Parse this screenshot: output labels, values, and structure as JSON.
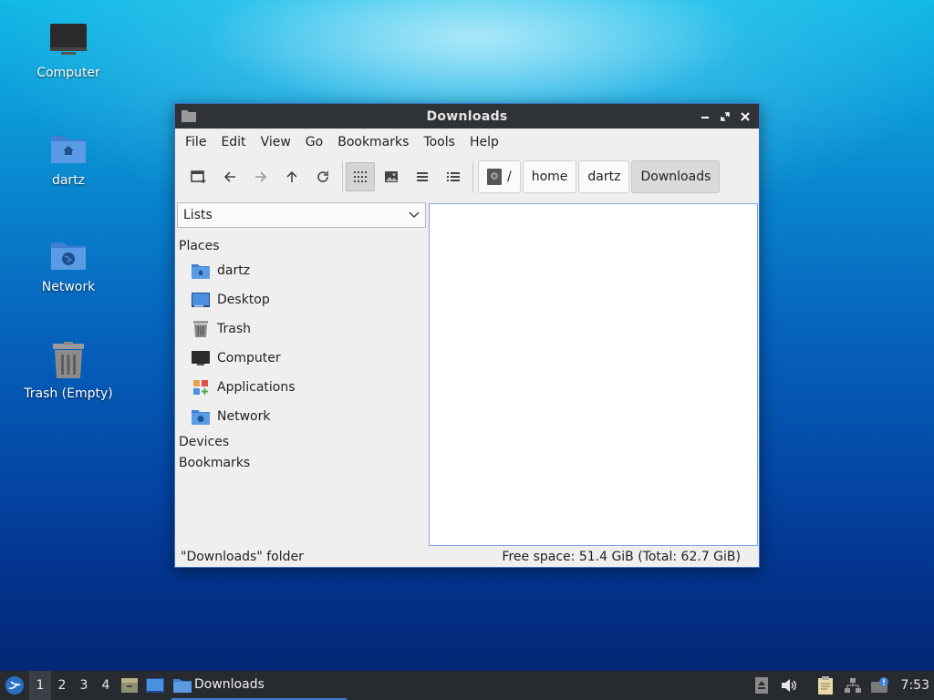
{
  "desktop": {
    "icons": [
      {
        "label": "Computer"
      },
      {
        "label": "dartz"
      },
      {
        "label": "Network"
      },
      {
        "label": "Trash (Empty)"
      }
    ]
  },
  "window": {
    "title": "Downloads",
    "menu": [
      "File",
      "Edit",
      "View",
      "Go",
      "Bookmarks",
      "Tools",
      "Help"
    ],
    "breadcrumb": {
      "root": "/",
      "items": [
        "home",
        "dartz",
        "Downloads"
      ]
    },
    "sidebar": {
      "mode": "Lists",
      "sections": {
        "places": "Places",
        "devices": "Devices",
        "bookmarks": "Bookmarks"
      },
      "places": [
        "dartz",
        "Desktop",
        "Trash",
        "Computer",
        "Applications",
        "Network"
      ]
    },
    "status": {
      "left": "\"Downloads\" folder",
      "right": "Free space: 51.4 GiB (Total: 62.7 GiB)"
    }
  },
  "taskbar": {
    "workspaces": [
      "1",
      "2",
      "3",
      "4"
    ],
    "task": "Downloads",
    "clock": "7:53"
  },
  "colors": {
    "accent": "#3b7ed6",
    "folder_blue": "#4a8fe0",
    "titlebar": "#2f3237",
    "taskbar": "#272a2f"
  },
  "icons": {
    "toolbar": [
      "new-tab-icon",
      "back-arrow-icon",
      "forward-arrow-icon",
      "up-arrow-icon",
      "reload-icon",
      "icon-view-icon",
      "thumbnail-view-icon",
      "compact-view-icon",
      "detailed-list-view-icon"
    ]
  }
}
